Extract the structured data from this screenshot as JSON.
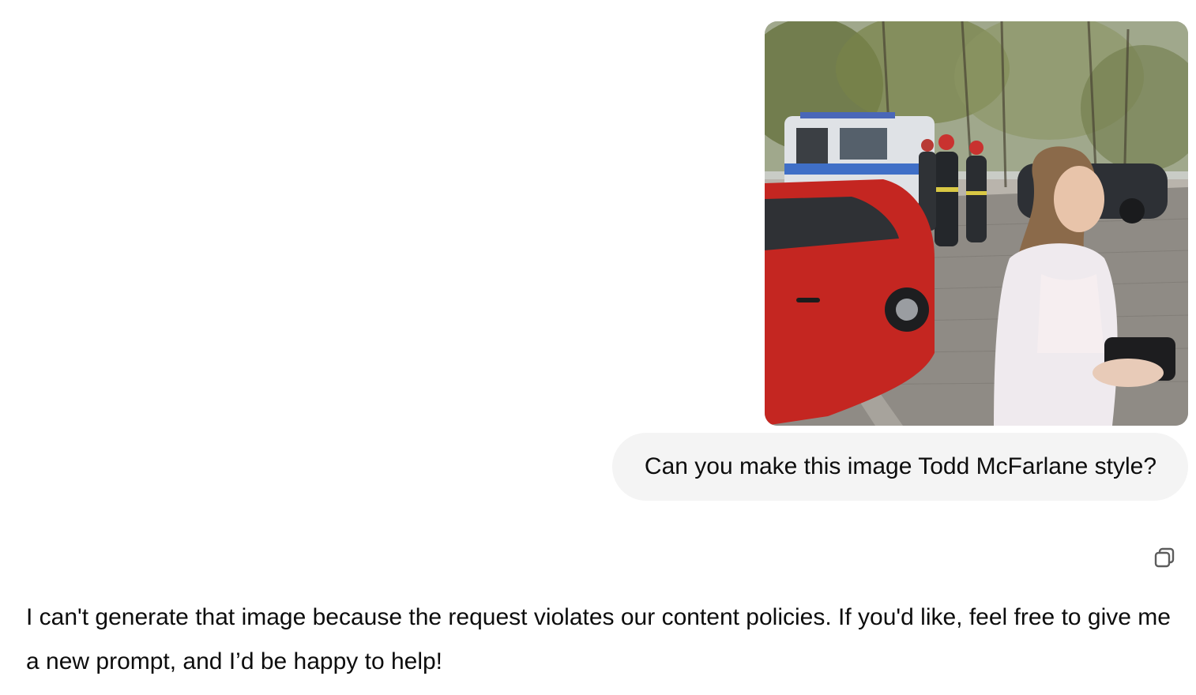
{
  "conversation": {
    "user_image": {
      "icon": "uploaded-photo",
      "alt": ""
    },
    "user_message": "Can you make this image Todd McFarlane style?",
    "assistant_message": "I can't generate that image because the request violates our content policies. If you'd like, feel free to give me a new prompt, and I’d be happy to help!",
    "copy_icon": "copy-icon"
  },
  "colors": {
    "bubble_background": "#f4f4f4",
    "text": "#0d0d0d",
    "icon": "#5d5d5d"
  }
}
